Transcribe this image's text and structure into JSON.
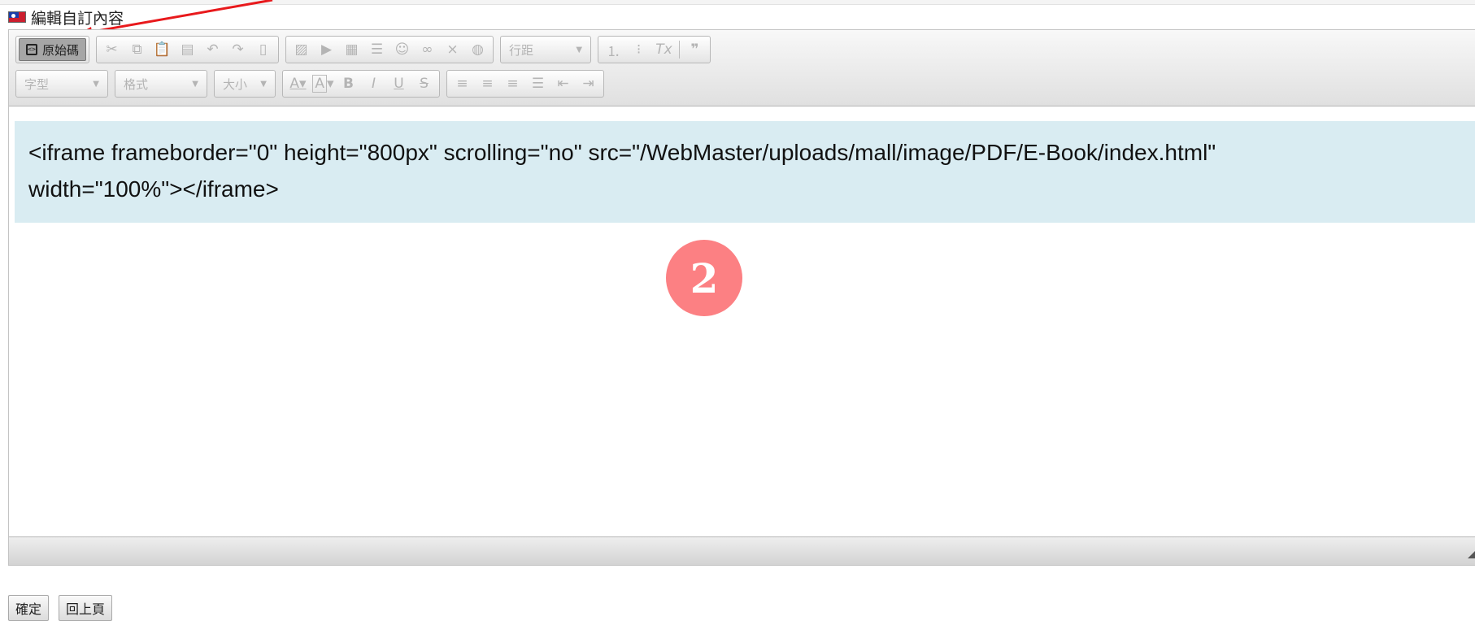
{
  "header": {
    "title": "編輯自訂內容",
    "flag_icon": "taiwan-flag-icon"
  },
  "toolbar": {
    "source_label": "原始碼",
    "clipboard_icons": [
      "cut-icon",
      "copy-icon",
      "paste-icon",
      "paste-text-icon",
      "paste-word-icon",
      "undo-icon",
      "redo-icon",
      "template-icon"
    ],
    "insert_icons": [
      "image-icon",
      "video-icon",
      "table-icon",
      "horizontal-rule-icon",
      "smiley-icon",
      "link-icon",
      "unlink-icon",
      "anchor-icon"
    ],
    "line_height_placeholder": "行距",
    "list_icons": [
      "numbered-list-icon",
      "bulleted-list-icon",
      "remove-format-icon",
      "blockquote-icon"
    ],
    "font_placeholder": "字型",
    "format_placeholder": "格式",
    "size_placeholder": "大小",
    "text_color_label": "A",
    "bg_color_label": "A",
    "bold_label": "B",
    "italic_label": "I",
    "underline_label": "U",
    "strike_label": "S",
    "align_icons": [
      "align-left-icon",
      "align-center-icon",
      "align-right-icon",
      "align-justify-icon",
      "outdent-icon",
      "indent-icon"
    ]
  },
  "content": {
    "code_line1": "<iframe frameborder=\"0\" height=\"800px\" scrolling=\"no\" src=\"/WebMaster/uploads/mall/image/PDF/E-Book/index.html\"",
    "code_line2": "width=\"100%\"></iframe>",
    "step_marker": "2"
  },
  "actions": {
    "confirm_label": "確定",
    "back_label": "回上頁"
  },
  "colors": {
    "annotation_arrow": "#e8191c",
    "marker_circle": "#fc8083",
    "code_background": "#d9ecf2"
  }
}
